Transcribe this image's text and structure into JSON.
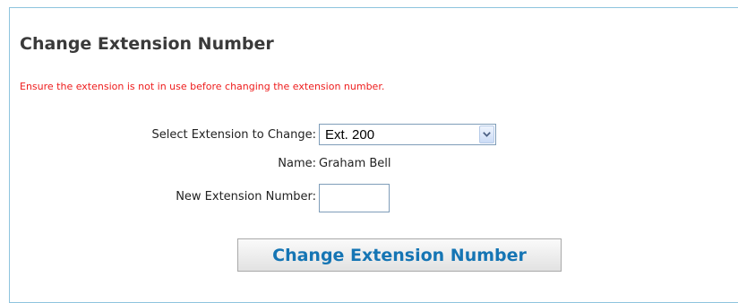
{
  "form": {
    "title": "Change Extension Number",
    "warning": "Ensure the extension is not in use before changing the extension number.",
    "select_extension": {
      "label": "Select Extension to Change:",
      "selected_value": "Ext. 200"
    },
    "name": {
      "label": "Name:",
      "value": "Graham Bell"
    },
    "new_extension": {
      "label": "New Extension Number:",
      "value": ""
    },
    "submit_label": "Change Extension Number"
  },
  "icons": {
    "select_arrow": "chevron-down-icon"
  },
  "colors": {
    "panel_border": "#8ec4de",
    "warning_text": "#ee1c1c",
    "button_text": "#1575b4",
    "title_text": "#3a3a3a"
  }
}
